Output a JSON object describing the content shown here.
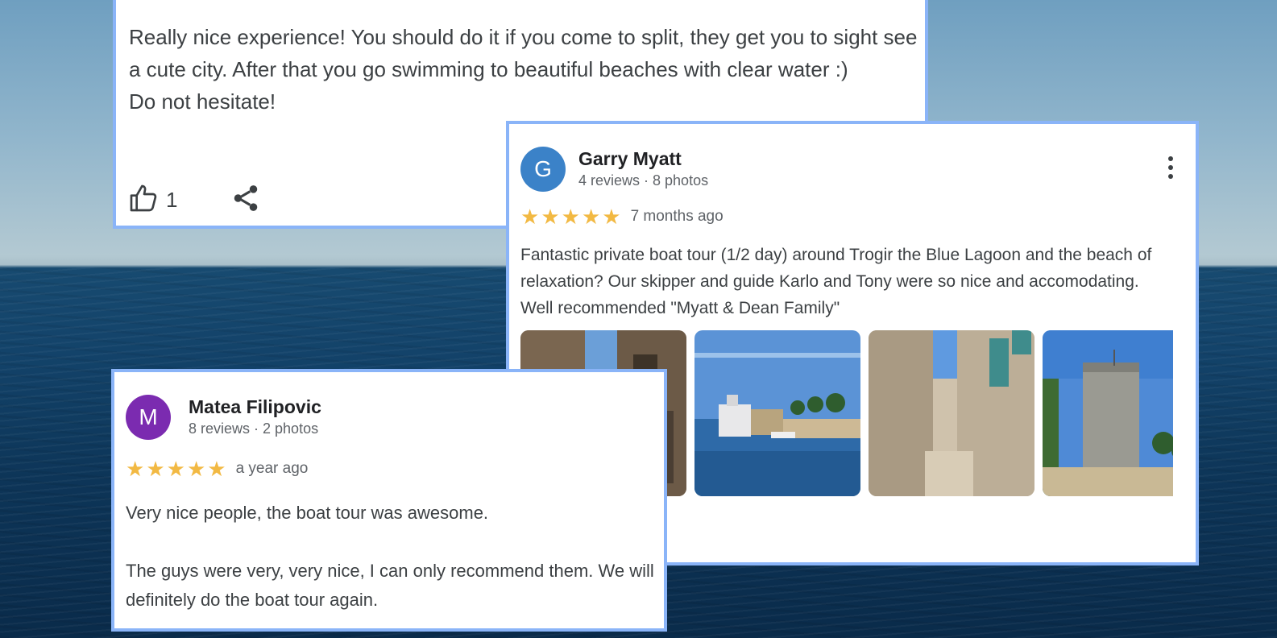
{
  "top_review": {
    "text": "Really nice experience! You should do it if you come to split, they get you to sight see a cute city. After that you go swimming to beautiful beaches with clear water :)\nDo not hesitate!",
    "like_count": "1",
    "like_icon": "thumbs-up-icon",
    "share_icon": "share-icon"
  },
  "garry_review": {
    "avatar_letter": "G",
    "avatar_color": "#3b82c8",
    "name": "Garry Myatt",
    "meta": "4 reviews · 8 photos",
    "rating": 5,
    "stars": "★★★★★",
    "time": "7 months ago",
    "text": "Fantastic private boat tour (1/2 day) around Trogir the Blue Lagoon and the beach of relaxation? Our skipper and guide Karlo and Tony were so nice and accomodating. Well recommended \"Myatt & Dean Family\"",
    "menu_icon": "more-vert-icon",
    "photos": [
      "alley-photo",
      "harbor-photo",
      "stone-street-photo",
      "tower-photo"
    ]
  },
  "matea_review": {
    "avatar_letter": "M",
    "avatar_color": "#7b2bb0",
    "name": "Matea Filipovic",
    "meta": "8 reviews · 2 photos",
    "rating": 5,
    "stars": "★★★★★",
    "time": "a year ago",
    "text": "Very nice people, the boat tour was awesome.\n\nThe guys were very, very nice, I can only recommend them. We will definitely do the boat tour again."
  },
  "colors": {
    "card_border": "#8ab4f8",
    "star": "#f2b943",
    "text_primary": "#202124",
    "text_secondary": "#5f6368"
  }
}
